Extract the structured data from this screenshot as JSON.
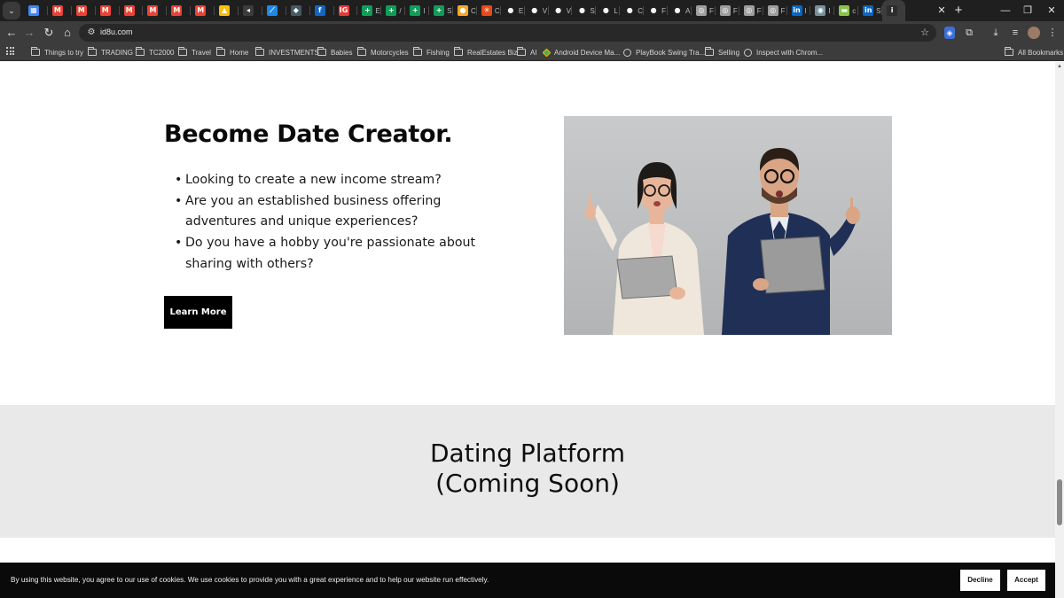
{
  "browser": {
    "url": "id8u.com",
    "tab_label_active": "i",
    "tabs": [
      {
        "icon": "calendar-icon",
        "color": "#4285f4",
        "glyph": "▦",
        "label": ""
      },
      {
        "icon": "gmail-icon",
        "color": "#ea4335",
        "glyph": "M",
        "label": ""
      },
      {
        "icon": "gmail-icon",
        "color": "#ea4335",
        "glyph": "M",
        "label": ""
      },
      {
        "icon": "gmail-icon",
        "color": "#ea4335",
        "glyph": "M",
        "label": ""
      },
      {
        "icon": "gmail-icon",
        "color": "#ea4335",
        "glyph": "M",
        "label": ""
      },
      {
        "icon": "gmail-icon",
        "color": "#ea4335",
        "glyph": "M",
        "label": ""
      },
      {
        "icon": "gmail-icon",
        "color": "#ea4335",
        "glyph": "M",
        "label": ""
      },
      {
        "icon": "gmail-icon",
        "color": "#ea4335",
        "glyph": "M",
        "label": ""
      },
      {
        "icon": "drive-icon",
        "color": "#fbbc04",
        "glyph": "▲",
        "label": ""
      },
      {
        "icon": "audio-icon",
        "color": "#3c3c3c",
        "glyph": "◂",
        "label": ""
      },
      {
        "icon": "chart-icon",
        "color": "#1e88e5",
        "glyph": "⟋",
        "label": ""
      },
      {
        "icon": "shield-icon",
        "color": "#455a64",
        "glyph": "◆",
        "label": ""
      },
      {
        "icon": "globe-icon",
        "color": "#1565c0",
        "glyph": "f",
        "label": ""
      },
      {
        "icon": "ig-icon",
        "color": "#e53935",
        "glyph": "IG",
        "label": ""
      },
      {
        "icon": "sheets-icon",
        "color": "#0f9d58",
        "glyph": "+",
        "label": "E"
      },
      {
        "icon": "sheets-icon",
        "color": "#0f9d58",
        "glyph": "+",
        "label": "/"
      },
      {
        "icon": "sheets-icon",
        "color": "#0f9d58",
        "glyph": "+",
        "label": "I"
      },
      {
        "icon": "sheets-icon",
        "color": "#0f9d58",
        "glyph": "+",
        "label": "S"
      },
      {
        "icon": "sun-icon",
        "color": "#f9a825",
        "glyph": "●",
        "label": "C"
      },
      {
        "icon": "burst-icon",
        "color": "#e64a19",
        "glyph": "✳",
        "label": "C"
      },
      {
        "icon": "github-icon",
        "color": "#f5f5f5",
        "glyph": "●",
        "label": "E"
      },
      {
        "icon": "github-icon",
        "color": "#f5f5f5",
        "glyph": "●",
        "label": "V"
      },
      {
        "icon": "github-icon",
        "color": "#f5f5f5",
        "glyph": "●",
        "label": "V"
      },
      {
        "icon": "github-icon",
        "color": "#f5f5f5",
        "glyph": "●",
        "label": "S"
      },
      {
        "icon": "github-icon",
        "color": "#f5f5f5",
        "glyph": "●",
        "label": "L"
      },
      {
        "icon": "github-icon",
        "color": "#f5f5f5",
        "glyph": "●",
        "label": "C"
      },
      {
        "icon": "github-icon",
        "color": "#f5f5f5",
        "glyph": "●",
        "label": "F"
      },
      {
        "icon": "github-icon",
        "color": "#f5f5f5",
        "glyph": "●",
        "label": "A"
      },
      {
        "icon": "globe-icon",
        "color": "#9e9e9e",
        "glyph": "◎",
        "label": "F"
      },
      {
        "icon": "globe-icon",
        "color": "#9e9e9e",
        "glyph": "◎",
        "label": "F"
      },
      {
        "icon": "globe-icon",
        "color": "#9e9e9e",
        "glyph": "◎",
        "label": "F"
      },
      {
        "icon": "globe-icon",
        "color": "#9e9e9e",
        "glyph": "◎",
        "label": "F"
      },
      {
        "icon": "linkedin-icon",
        "color": "#0a66c2",
        "glyph": "in",
        "label": "I"
      },
      {
        "icon": "globe-icon",
        "color": "#78909c",
        "glyph": "◉",
        "label": "I"
      },
      {
        "icon": "flag-icon",
        "color": "#8bc34a",
        "glyph": "▬",
        "label": "c"
      },
      {
        "icon": "linkedin-icon",
        "color": "#0a66c2",
        "glyph": "in",
        "label": "S"
      }
    ],
    "bookmarks": [
      {
        "label": "Things to try",
        "type": "folder"
      },
      {
        "label": "TRADING",
        "type": "folder"
      },
      {
        "label": "TC2000",
        "type": "folder"
      },
      {
        "label": "Travel",
        "type": "folder"
      },
      {
        "label": "Home",
        "type": "folder"
      },
      {
        "label": "INVESTMENTS",
        "type": "folder"
      },
      {
        "label": "Babies",
        "type": "folder"
      },
      {
        "label": "Motorcycles",
        "type": "folder"
      },
      {
        "label": "Fishing",
        "type": "folder"
      },
      {
        "label": "RealEstates Biz",
        "type": "folder"
      },
      {
        "label": "AI",
        "type": "folder"
      },
      {
        "label": "Android Device Ma...",
        "type": "app"
      },
      {
        "label": "PlayBook Swing Tra...",
        "type": "globe"
      },
      {
        "label": "Selling",
        "type": "folder"
      },
      {
        "label": "Inspect with Chrom...",
        "type": "globe"
      }
    ],
    "all_bookmarks": "All Bookmarks"
  },
  "hero": {
    "title": "Become Date Creator.",
    "bullets": [
      "Looking to create a new income stream?",
      "Are you an established business offering adventures and unique experiences?",
      "Do you have a hobby you're passionate about sharing with others?"
    ],
    "cta_label": "Learn More"
  },
  "section2": {
    "title_line1": "Dating Platform",
    "title_line2": "(Coming Soon)"
  },
  "cookie_banner": {
    "text": "By using this website, you agree to our use of cookies. We use cookies to provide you with a great experience and to help our website run effectively.",
    "decline_label": "Decline",
    "accept_label": "Accept"
  }
}
